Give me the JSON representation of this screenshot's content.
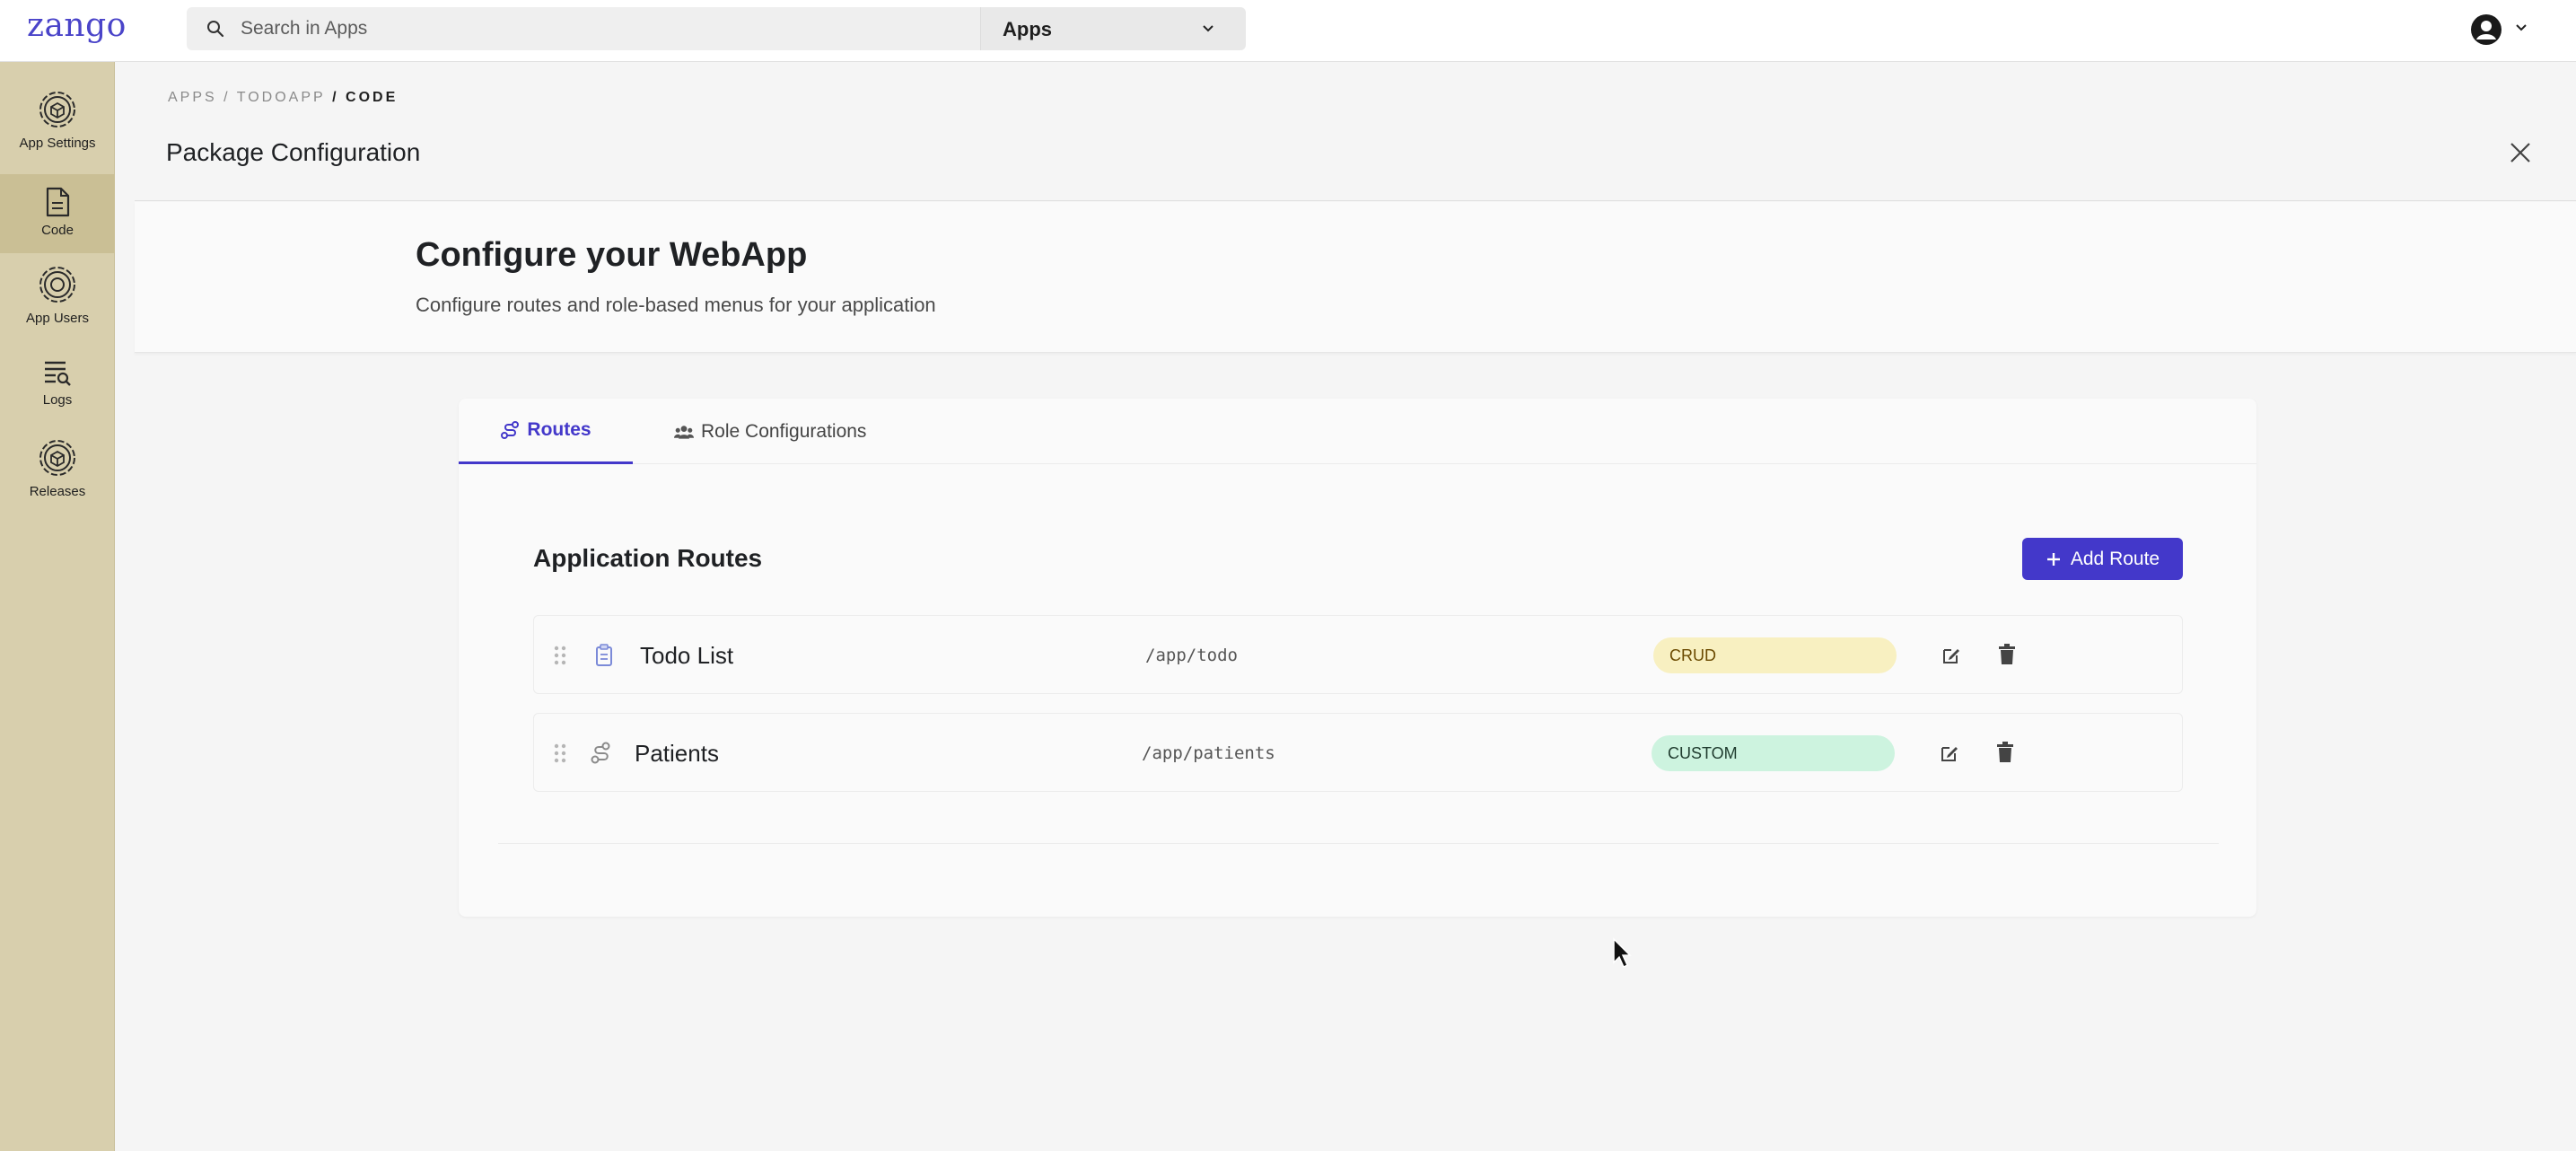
{
  "brand": {
    "logo": "zango"
  },
  "search": {
    "placeholder": "Search in Apps",
    "scope_label": "Apps"
  },
  "sidebar": {
    "items": [
      {
        "label": "App Settings",
        "icon": "gear-icon"
      },
      {
        "label": "Code",
        "icon": "file-code-icon",
        "active": true
      },
      {
        "label": "App Users",
        "icon": "gear-icon"
      },
      {
        "label": "Logs",
        "icon": "logs-search-icon"
      },
      {
        "label": "Releases",
        "icon": "gear-icon"
      }
    ]
  },
  "breadcrumb": {
    "part1": "APPS",
    "sep1": " / ",
    "part2": "TODOAPP",
    "sep2": " / ",
    "current": "CODE"
  },
  "page": {
    "title": "Package Configuration"
  },
  "hero": {
    "title": "Configure your WebApp",
    "subtitle": "Configure routes and role-based menus for your application"
  },
  "tabs": [
    {
      "label": "Routes",
      "icon": "route-icon",
      "active": true
    },
    {
      "label": "Role Configurations",
      "icon": "users-icon",
      "active": false
    }
  ],
  "routes_section": {
    "title": "Application Routes",
    "add_label": "Add Route",
    "routes": [
      {
        "name": "Todo List",
        "path": "/app/todo",
        "type": "CRUD",
        "icon": "clipboard-icon"
      },
      {
        "name": "Patients",
        "path": "/app/patients",
        "type": "CUSTOM",
        "icon": "route-icon"
      }
    ]
  },
  "colors": {
    "accent": "#4338ca",
    "sidebar": "#d8cfad",
    "crud_badge": "#f8f0c1",
    "custom_badge": "#cdf3df"
  }
}
